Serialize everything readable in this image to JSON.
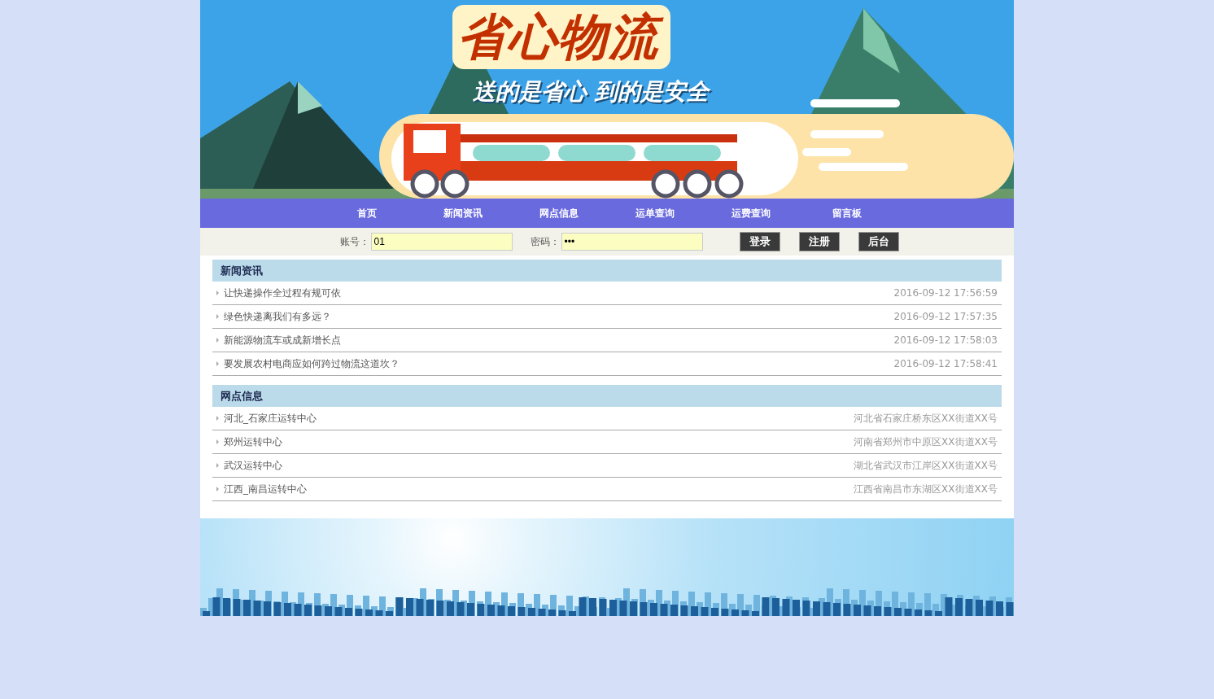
{
  "banner": {
    "title": "省心物流",
    "slogan": "送的是省心 到的是安全"
  },
  "nav": [
    {
      "label": "首页"
    },
    {
      "label": "新闻资讯"
    },
    {
      "label": "网点信息"
    },
    {
      "label": "运单查询"
    },
    {
      "label": "运费查询"
    },
    {
      "label": "留言板"
    }
  ],
  "login": {
    "account_label": "账号：",
    "account_value": "01",
    "password_label": "密码：",
    "password_value": "•••",
    "buttons": [
      "登录",
      "注册",
      "后台"
    ]
  },
  "sections": [
    {
      "title": "新闻资讯",
      "rows": [
        {
          "text": "让快递操作全过程有规可依",
          "meta": "2016-09-12 17:56:59"
        },
        {
          "text": "绿色快递离我们有多远？",
          "meta": "2016-09-12 17:57:35"
        },
        {
          "text": "新能源物流车或成新增长点",
          "meta": "2016-09-12 17:58:03"
        },
        {
          "text": "要发展农村电商应如何跨过物流这道坎？",
          "meta": "2016-09-12 17:58:41"
        }
      ]
    },
    {
      "title": "网点信息",
      "rows": [
        {
          "text": "河北_石家庄运转中心",
          "meta": "河北省石家庄桥东区XX街道XX号"
        },
        {
          "text": "郑州运转中心",
          "meta": "河南省郑州市中原区XX街道XX号"
        },
        {
          "text": "武汉运转中心",
          "meta": "湖北省武汉市江岸区XX街道XX号"
        },
        {
          "text": "江西_南昌运转中心",
          "meta": "江西省南昌市东湖区XX街道XX号"
        }
      ]
    }
  ]
}
